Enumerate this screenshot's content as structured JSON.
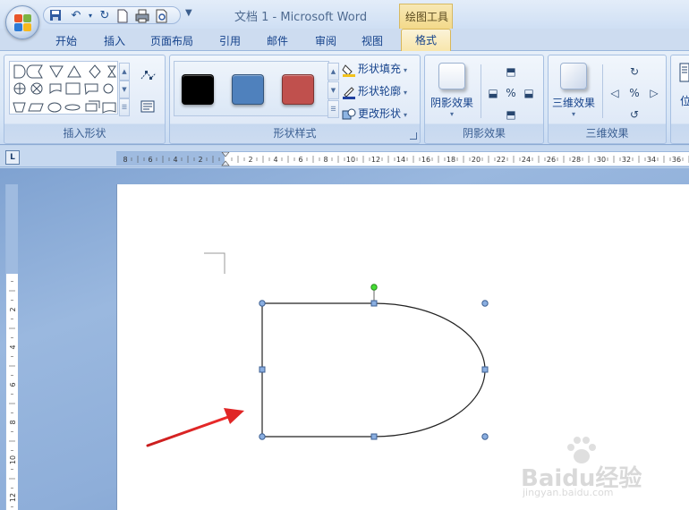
{
  "window": {
    "title": "文档 1 - Microsoft Word",
    "contextual_group": "绘图工具"
  },
  "tabs": [
    {
      "label": "开始"
    },
    {
      "label": "插入"
    },
    {
      "label": "页面布局"
    },
    {
      "label": "引用"
    },
    {
      "label": "邮件"
    },
    {
      "label": "审阅"
    },
    {
      "label": "视图"
    }
  ],
  "active_tab": "格式",
  "quick_access": {
    "icons": [
      "save-icon",
      "undo-icon",
      "redo-icon",
      "new-document-icon",
      "print-icon",
      "print-preview-icon"
    ]
  },
  "ribbon": {
    "insert_shapes": {
      "label": "插入形状"
    },
    "shape_styles": {
      "label": "形状样式",
      "swatch_colors": [
        "#000000",
        "#4f81bd",
        "#c0504d"
      ],
      "fill_label": "形状填充",
      "outline_label": "形状轮廓",
      "change_shape_label": "更改形状"
    },
    "shadow_effects": {
      "label": "阴影效果",
      "button_label": "阴影效果"
    },
    "threed_effects": {
      "label": "三维效果",
      "button_label": "三维效果"
    },
    "position": {
      "button_label": "位"
    }
  },
  "ruler": {
    "horizontal_ticks": [
      "8",
      "6",
      "4",
      "2",
      "",
      "2",
      "4",
      "6",
      "8",
      "10",
      "12",
      "14",
      "16",
      "18",
      "20",
      "22",
      "24",
      "26",
      "28",
      "30",
      "32",
      "34",
      "36"
    ],
    "vertical_ticks": [
      "4",
      "2",
      "",
      "2",
      "4",
      "6",
      "8",
      "10",
      "12"
    ],
    "button_label": "L"
  },
  "watermark": {
    "logo": "Baidu经验",
    "url": "jingyan.baidu.com"
  }
}
